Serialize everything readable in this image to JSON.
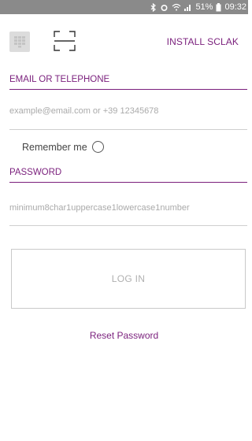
{
  "status_bar": {
    "battery": "51%",
    "time": "09:32",
    "icons": [
      "bluetooth-icon",
      "alarm-icon",
      "wifi-icon",
      "signal-icon",
      "battery-icon"
    ]
  },
  "toolbar": {
    "keypad_icon": "keypad-icon",
    "scan_icon": "scan-icon",
    "install_label": "INSTALL SCLAK"
  },
  "form": {
    "email_label": "EMAIL OR TELEPHONE",
    "email_placeholder": "example@email.com or +39 12345678",
    "email_value": "",
    "remember_label": "Remember me",
    "remember_checked": false,
    "password_label": "PASSWORD",
    "password_placeholder": "minimum8char1uppercase1lowercase1number",
    "password_value": "",
    "login_label": "LOG IN",
    "reset_label": "Reset Password"
  },
  "colors": {
    "accent": "#7a1f7c",
    "status_bar": "#8a8a8a",
    "divider": "#cfcfcf"
  }
}
